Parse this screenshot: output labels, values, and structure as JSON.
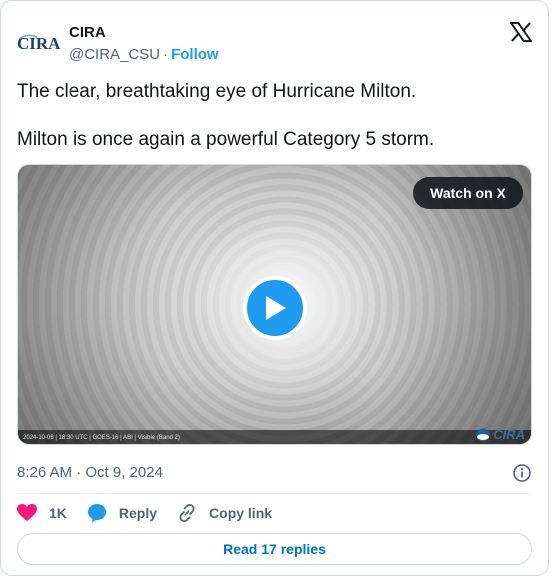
{
  "author": {
    "name": "CIRA",
    "handle": "@CIRA_CSU",
    "separator": "·",
    "follow_label": "Follow",
    "avatar_text": "CIRA"
  },
  "tweet": {
    "paragraphs": [
      "The clear, breathtaking eye of Hurricane Milton.",
      "Milton is once again a powerful Category 5 storm."
    ]
  },
  "media": {
    "watch_label": "Watch on X",
    "caption": "2024-10-08 | 18:30 UTC | GOES-16 | ABI | Visible (Band 2)",
    "logo_text": "CIRA"
  },
  "meta": {
    "timestamp": "8:26 AM · Oct 9, 2024"
  },
  "actions": {
    "like_count": "1K",
    "reply_label": "Reply",
    "copy_link_label": "Copy link"
  },
  "replies_button": {
    "label": "Read 17 replies"
  },
  "colors": {
    "accent": "#1d9bf0",
    "like": "#f91880",
    "secondary_text": "#536471",
    "link": "#006fd6"
  },
  "icons": [
    "x-logo-icon",
    "play-icon",
    "info-icon",
    "heart-icon",
    "reply-bubble-icon",
    "link-icon",
    "noaa-icon"
  ]
}
